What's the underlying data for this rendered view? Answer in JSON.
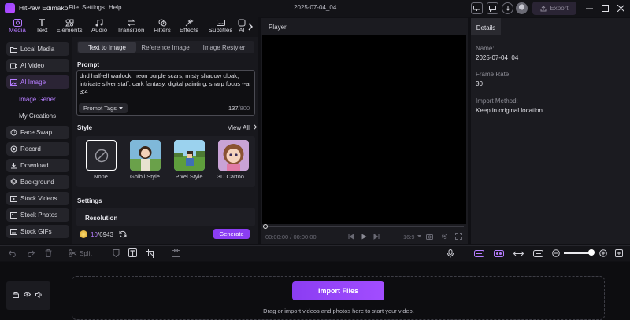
{
  "titlebar": {
    "app_name": "HitPaw Edimakor",
    "menu": [
      "File",
      "Settings",
      "Help"
    ],
    "project_title": "2025-07-04_04",
    "export_label": "Export"
  },
  "tool_tabs": [
    {
      "label": "Media",
      "icon": "media-icon",
      "active": true
    },
    {
      "label": "Text",
      "icon": "text-icon"
    },
    {
      "label": "Elements",
      "icon": "elements-icon"
    },
    {
      "label": "Audio",
      "icon": "audio-icon"
    },
    {
      "label": "Transition",
      "icon": "transition-icon"
    },
    {
      "label": "Filters",
      "icon": "filters-icon"
    },
    {
      "label": "Effects",
      "icon": "effects-icon"
    },
    {
      "label": "Subtitles",
      "icon": "subtitles-icon"
    },
    {
      "label": "AI",
      "icon": "ai-icon"
    }
  ],
  "sidebar": {
    "items": [
      {
        "label": "Local Media",
        "icon": "folder-icon"
      },
      {
        "label": "AI Video",
        "icon": "ai-video-icon"
      },
      {
        "label": "AI Image",
        "icon": "ai-image-icon",
        "active": true
      },
      {
        "label": "Face Swap",
        "icon": "face-swap-icon"
      },
      {
        "label": "Record",
        "icon": "record-icon"
      },
      {
        "label": "Download",
        "icon": "download-icon"
      },
      {
        "label": "Background",
        "icon": "background-icon"
      },
      {
        "label": "Stock Videos",
        "icon": "stock-videos-icon"
      },
      {
        "label": "Stock Photos",
        "icon": "stock-photos-icon"
      },
      {
        "label": "Stock GIFs",
        "icon": "stock-gifs-icon"
      }
    ],
    "subitems": [
      {
        "label": "Image Gener...",
        "active": true
      },
      {
        "label": "My Creations"
      }
    ]
  },
  "ai_image": {
    "subtabs": [
      "Text to Image",
      "Reference Image",
      "Image Restyler"
    ],
    "prompt_title": "Prompt",
    "prompt_text": "dnd half-elf warlock, neon purple scars, misty shadow cloak, intricate silver staff, dark fantasy, digital painting, sharp focus --ar 3:4",
    "prompt_tags_label": "Prompt Tags",
    "char_count": "137",
    "char_max": "/800",
    "style_title": "Style",
    "view_all": "View All",
    "styles": [
      {
        "label": "None"
      },
      {
        "label": "Ghibli Style"
      },
      {
        "label": "Pixel Style"
      },
      {
        "label": "3D Cartoo..."
      }
    ],
    "settings_title": "Settings",
    "resolution_label": "Resolution",
    "credits_used": "10",
    "credits_total": "/6943",
    "generate_label": "Generate"
  },
  "player": {
    "title": "Player",
    "timecode": "00:00:00 / 00:00:00",
    "ratio": "16:9"
  },
  "details": {
    "tab": "Details",
    "fields": [
      {
        "label": "Name:",
        "value": "2025-07-04_04"
      },
      {
        "label": "Frame Rate:",
        "value": "30"
      },
      {
        "label": "Import Method:",
        "value": "Keep in original location"
      }
    ]
  },
  "timeline": {
    "split_label": "Split",
    "zoom_level": 0.9,
    "import_label": "Import Files",
    "drop_hint": "Drag or import videos and photos here to start your video."
  },
  "colors": {
    "accent": "#8b3df2",
    "accent_text": "#b67dff",
    "background": "#101014",
    "panel": "#1b1b20"
  }
}
